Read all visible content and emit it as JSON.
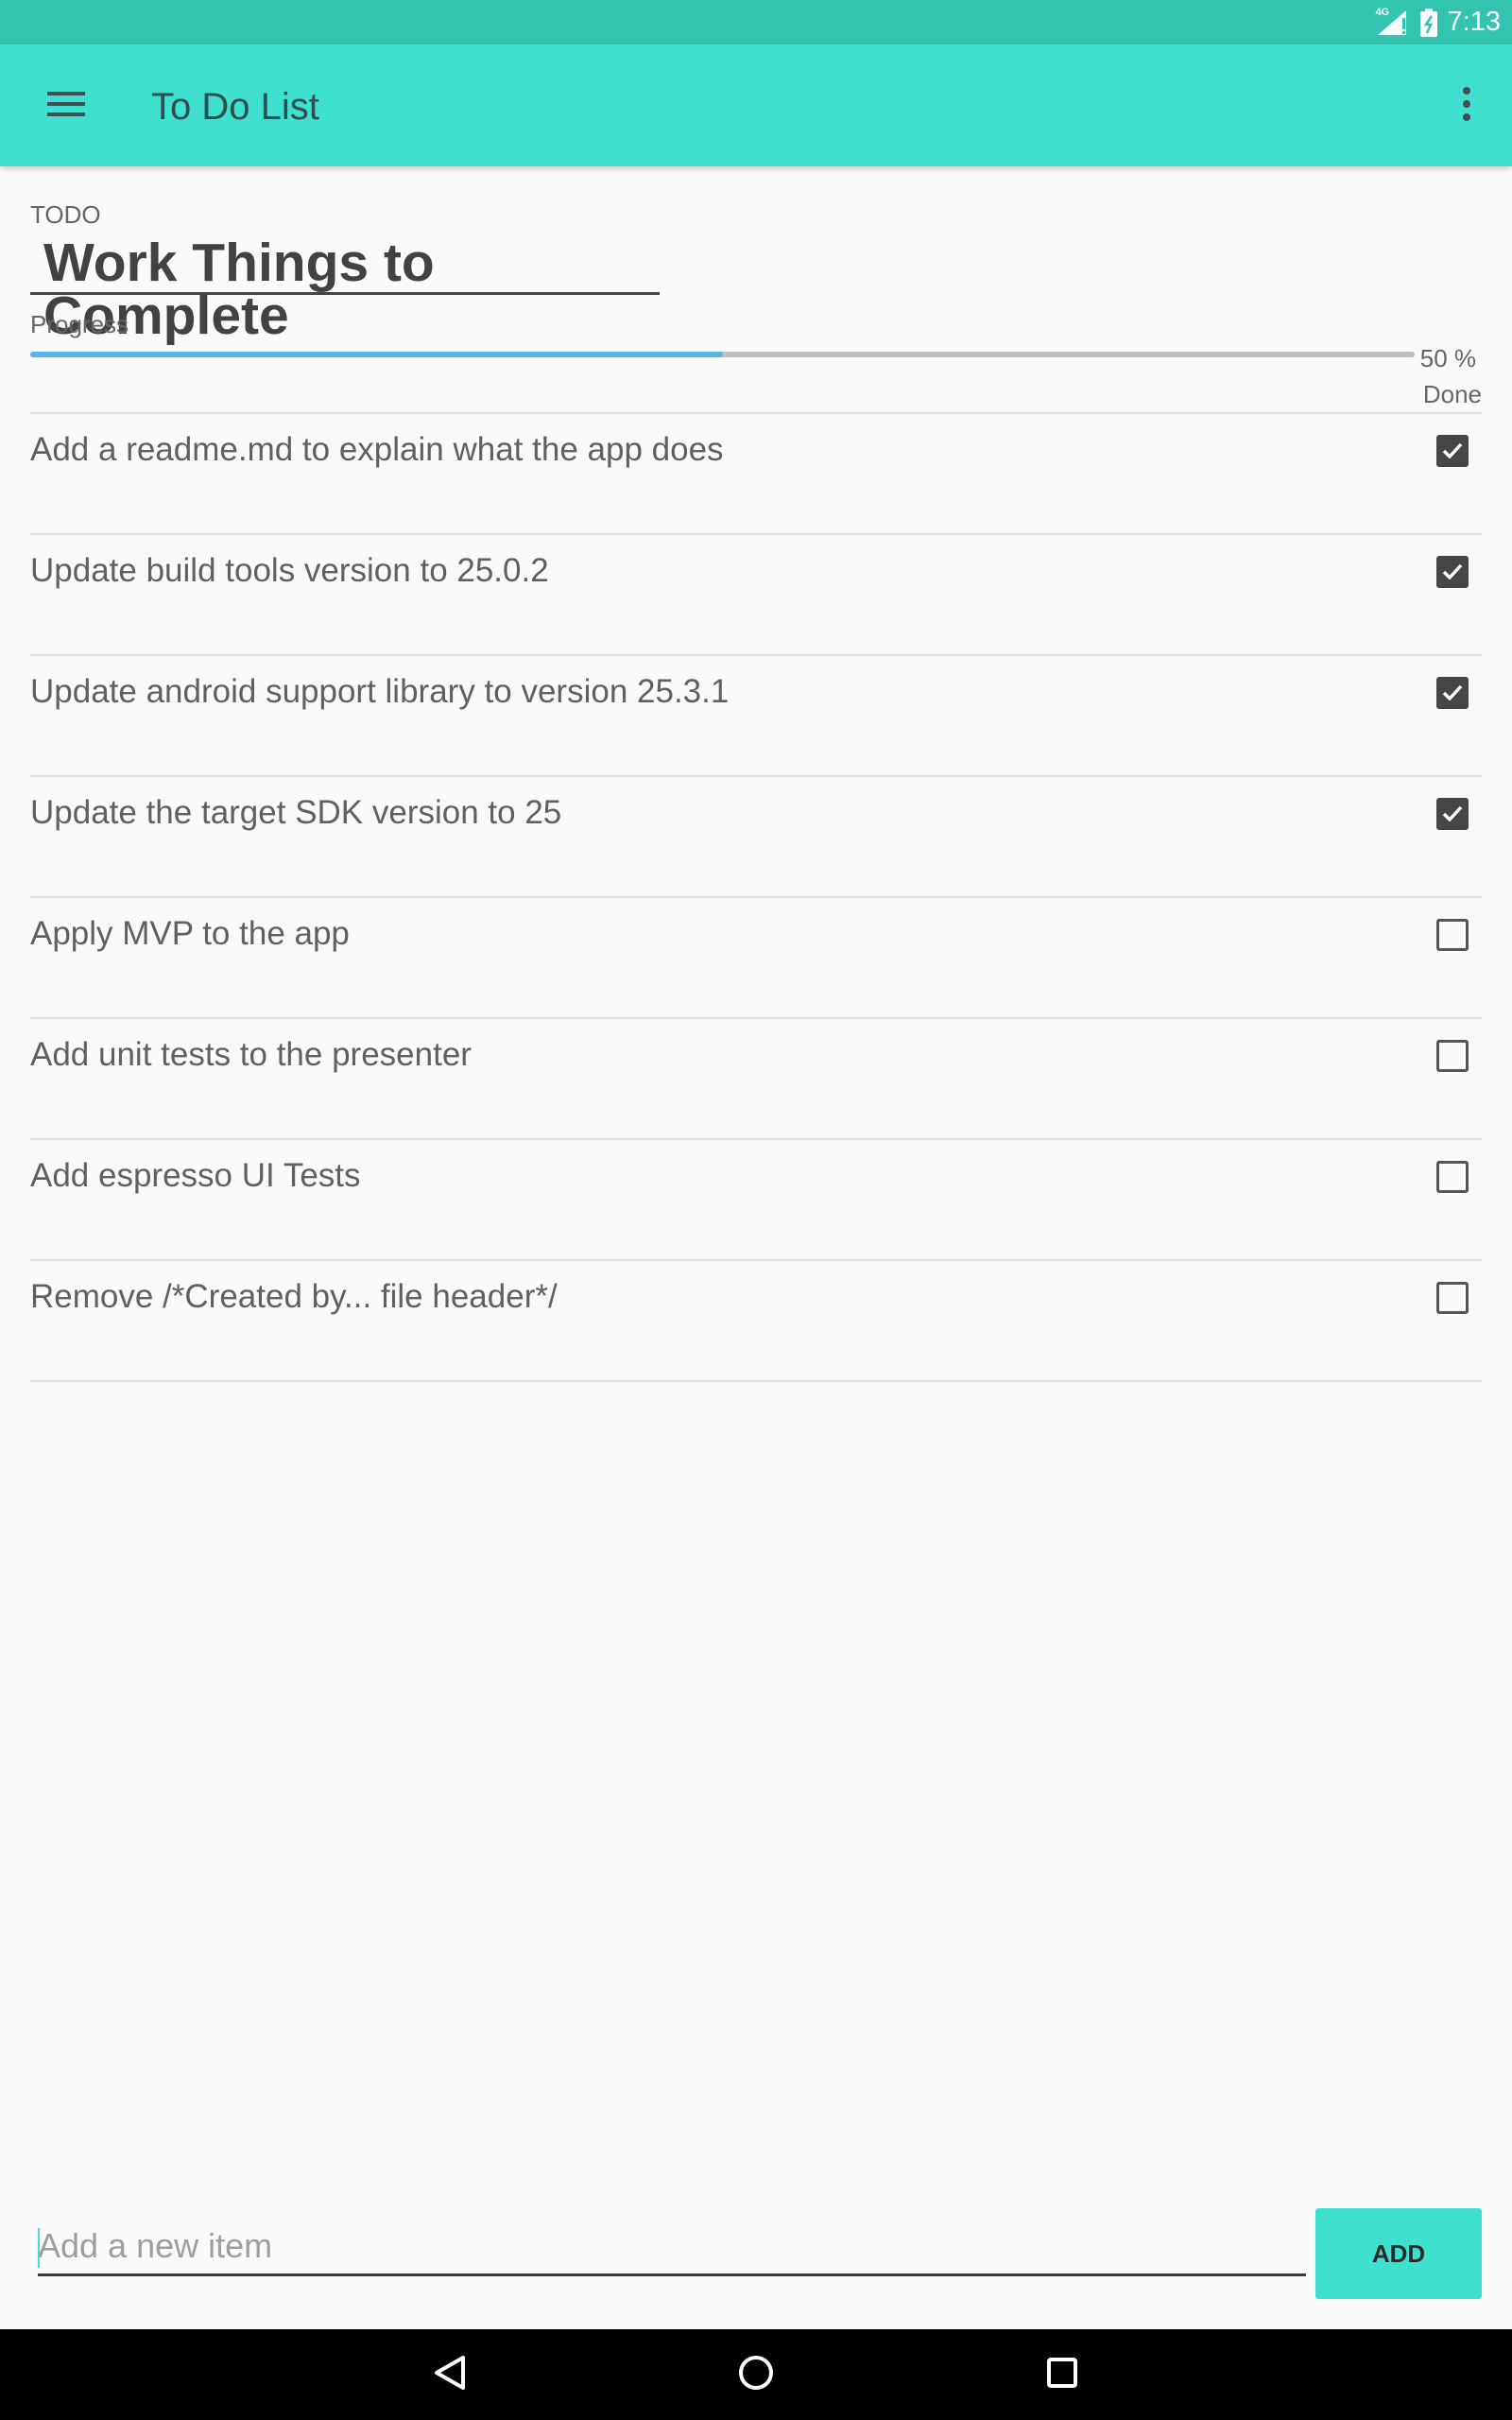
{
  "status_bar": {
    "network_label": "4G",
    "time": "7:13"
  },
  "app_bar": {
    "title": "To Do List",
    "menu_icon": "hamburger-menu-icon",
    "overflow_icon": "more-vertical-icon"
  },
  "list": {
    "section_label": "TODO",
    "title": "Work Things to Complete",
    "progress_label": "Progress",
    "progress_value": 0.5,
    "progress_percent": "50 %",
    "progress_done": "Done",
    "items": [
      {
        "text": "Add a readme.md to explain what the app does",
        "checked": true
      },
      {
        "text": "Update build tools version to 25.0.2",
        "checked": true
      },
      {
        "text": "Update android support library to version 25.3.1",
        "checked": true
      },
      {
        "text": "Update the target SDK version to 25",
        "checked": true
      },
      {
        "text": "Apply MVP to the app",
        "checked": false
      },
      {
        "text": "Add unit tests to the presenter",
        "checked": false
      },
      {
        "text": "Add espresso UI Tests",
        "checked": false
      },
      {
        "text": "Remove /*Created by... file header*/",
        "checked": false
      }
    ]
  },
  "new_item": {
    "placeholder": "Add a new item",
    "value": "",
    "add_label": "ADD"
  },
  "nav_bar": {
    "back_icon": "back-triangle-icon",
    "home_icon": "home-circle-icon",
    "recents_icon": "recents-square-icon"
  },
  "colors": {
    "accent": "#40e0d0",
    "status_bar": "#33c3b1",
    "progress": "#56b4e9"
  }
}
